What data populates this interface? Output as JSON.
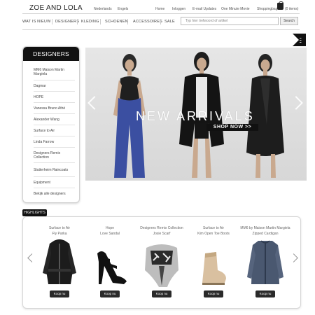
{
  "header": {
    "logo": "ZOE AND LOLA",
    "languages": [
      "Nederlands",
      "Engels"
    ],
    "links": [
      "Home",
      "Inloggen",
      "E-mail Updates",
      "One Minute Movie"
    ],
    "cart_label": "Shoppingbag",
    "cart_count": "(0 items)"
  },
  "category_nav": [
    "WAT IS NIEUW",
    "DESIGNERS",
    "KLEDING",
    "SCHOENEN",
    "ACCESSOIRES",
    "SALE"
  ],
  "search": {
    "placeholder": "Typ hier trefwoord of artikel",
    "button_label": "Search"
  },
  "designers": {
    "title": "DESIGNERS",
    "items": [
      "MM6 Maison Martin Margiela",
      "Dagmar",
      "HOPE",
      "Vanessa Bruno Athé",
      "Alexander Wang",
      "Surface to Air",
      "Linda Farrow",
      "Designers Remix Collection",
      "Stutterheim Raincoats",
      "Equipment",
      "Bekijk alle designers"
    ]
  },
  "banner": {
    "title": "NEW ARRIVALS",
    "cta": "SHOP NOW >>"
  },
  "highlights": {
    "label": "HIGHLIGHTS",
    "buy_label": "Koop nu",
    "products": [
      {
        "designer": "Surface to Air",
        "name": "Fly Parka",
        "icon": "parka-image"
      },
      {
        "designer": "Hope",
        "name": "Love Sandal",
        "icon": "sandal-image"
      },
      {
        "designer": "Designers Remix Collection",
        "name": "Josie Scarf",
        "icon": "scarf-image"
      },
      {
        "designer": "Surface to Air",
        "name": "Kim Open Toe Boots",
        "icon": "boots-image"
      },
      {
        "designer": "MM6 by Maison Martin Margiela",
        "name": "Zipped Cardigan",
        "icon": "cardigan-image"
      }
    ]
  },
  "colors": {
    "black": "#111111",
    "banner_bg": "#dcdcdc",
    "text": "#444444"
  }
}
